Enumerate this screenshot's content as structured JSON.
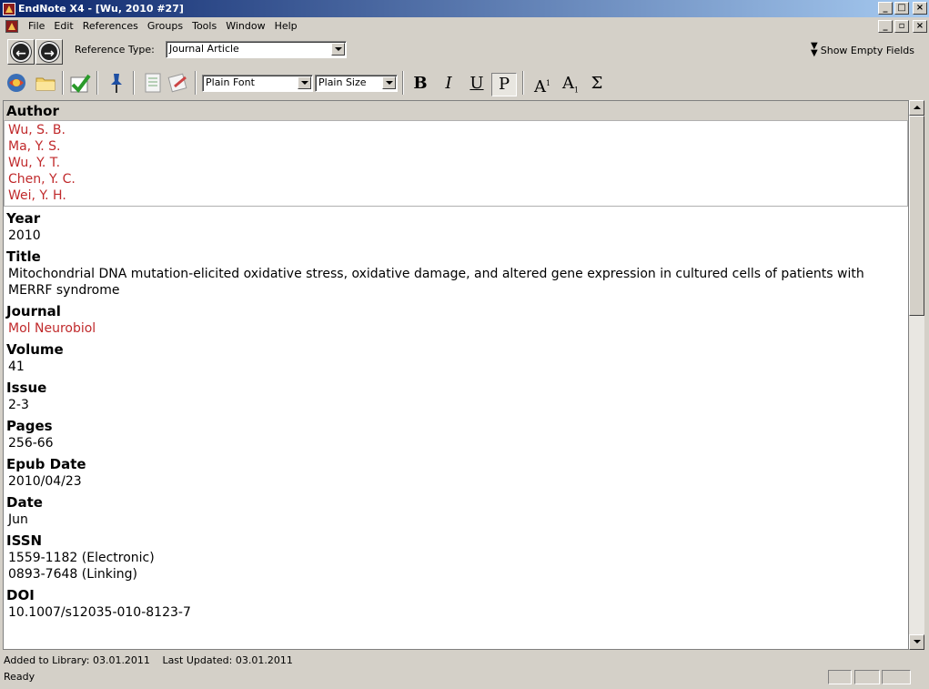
{
  "window": {
    "title": "EndNote X4 - [Wu, 2010 #27]"
  },
  "menu": [
    "File",
    "Edit",
    "References",
    "Groups",
    "Tools",
    "Window",
    "Help"
  ],
  "reference_type": {
    "label": "Reference Type:",
    "value": "Journal Article"
  },
  "show_empty_fields": "Show Empty Fields",
  "toolbar": {
    "font": "Plain Font",
    "size": "Plain Size",
    "bold": "B",
    "italic": "I",
    "underline": "U",
    "plain": "P",
    "superscript": "A",
    "subscript": "A",
    "symbol": "Σ"
  },
  "fields": {
    "author": {
      "label": "Author",
      "values": [
        "Wu, S. B.",
        "Ma, Y. S.",
        "Wu, Y. T.",
        "Chen, Y. C.",
        "Wei, Y. H."
      ]
    },
    "year": {
      "label": "Year",
      "value": "2010"
    },
    "title": {
      "label": "Title",
      "value": "Mitochondrial DNA mutation-elicited oxidative stress, oxidative damage, and altered gene expression in cultured cells of patients with MERRF syndrome"
    },
    "journal": {
      "label": "Journal",
      "value": "Mol Neurobiol"
    },
    "volume": {
      "label": "Volume",
      "value": "41"
    },
    "issue": {
      "label": "Issue",
      "value": "2-3"
    },
    "pages": {
      "label": "Pages",
      "value": "256-66"
    },
    "epub_date": {
      "label": "Epub Date",
      "value": "2010/04/23"
    },
    "date": {
      "label": "Date",
      "value": "Jun"
    },
    "issn": {
      "label": "ISSN",
      "values": [
        "1559-1182 (Electronic)",
        "0893-7648 (Linking)"
      ]
    },
    "doi": {
      "label": "DOI",
      "value": "10.1007/s12035-010-8123-7"
    }
  },
  "info": {
    "added": "Added to Library: 03.01.2011",
    "updated": "Last Updated: 03.01.2011"
  },
  "status": "Ready",
  "colors": {
    "title_bar": "#0a246a",
    "highlight_text": "#c0292b",
    "chrome": "#d4d0c8"
  }
}
